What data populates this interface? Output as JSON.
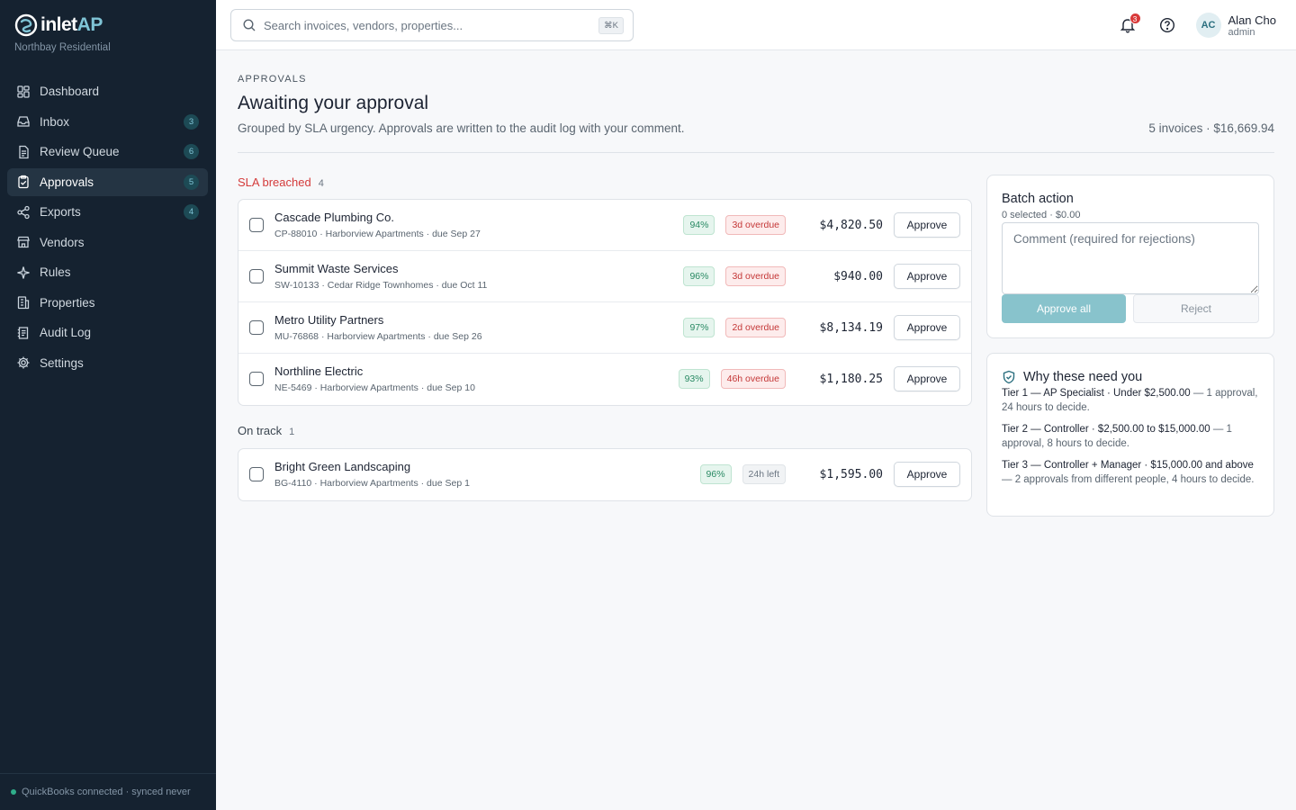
{
  "brand": {
    "name_main": "inlet",
    "name_accent": "AP",
    "org": "Northbay Residential"
  },
  "nav": [
    {
      "label": "Dashboard",
      "icon": "dashboard-icon",
      "badge": ""
    },
    {
      "label": "Inbox",
      "icon": "inbox-icon",
      "badge": "3"
    },
    {
      "label": "Review Queue",
      "icon": "review-queue-icon",
      "badge": "6"
    },
    {
      "label": "Approvals",
      "icon": "approvals-icon",
      "badge": "5",
      "active": true
    },
    {
      "label": "Exports",
      "icon": "exports-icon",
      "badge": "4"
    },
    {
      "label": "Vendors",
      "icon": "vendors-icon",
      "badge": ""
    },
    {
      "label": "Rules",
      "icon": "rules-icon",
      "badge": ""
    },
    {
      "label": "Properties",
      "icon": "properties-icon",
      "badge": ""
    },
    {
      "label": "Audit Log",
      "icon": "audit-log-icon",
      "badge": ""
    },
    {
      "label": "Settings",
      "icon": "gear-icon",
      "badge": ""
    }
  ],
  "sidebar_footer": "QuickBooks connected · synced never",
  "search": {
    "placeholder": "Search invoices, vendors, properties...",
    "shortcut": "⌘K"
  },
  "notifications": {
    "count": "3"
  },
  "user": {
    "initials": "AC",
    "name": "Alan Cho",
    "role": "admin"
  },
  "page": {
    "eyebrow": "APPROVALS",
    "title": "Awaiting your approval",
    "subtitle": "Grouped by SLA urgency. Approvals are written to the audit log with your comment.",
    "summary": "5 invoices · $16,669.94"
  },
  "groups": {
    "breached": {
      "label": "SLA breached",
      "count": "4",
      "rows": [
        {
          "vendor": "Cascade Plumbing Co.",
          "meta": "CP-88010 · Harborview Apartments · due Sep 27",
          "confidence": "94%",
          "sla": "3d overdue",
          "amount": "$4,820.50",
          "action": "Approve"
        },
        {
          "vendor": "Summit Waste Services",
          "meta": "SW-10133 · Cedar Ridge Townhomes · due Oct 11",
          "confidence": "96%",
          "sla": "3d overdue",
          "amount": "$940.00",
          "action": "Approve"
        },
        {
          "vendor": "Metro Utility Partners",
          "meta": "MU-76868 · Harborview Apartments · due Sep 26",
          "confidence": "97%",
          "sla": "2d overdue",
          "amount": "$8,134.19",
          "action": "Approve"
        },
        {
          "vendor": "Northline Electric",
          "meta": "NE-5469 · Harborview Apartments · due Sep 10",
          "confidence": "93%",
          "sla": "46h overdue",
          "amount": "$1,180.25",
          "action": "Approve"
        }
      ]
    },
    "on_track": {
      "label": "On track",
      "count": "1",
      "rows": [
        {
          "vendor": "Bright Green Landscaping",
          "meta": "BG-4110 · Harborview Apartments · due Sep 1",
          "confidence": "96%",
          "sla": "24h left",
          "amount": "$1,595.00",
          "action": "Approve"
        }
      ]
    }
  },
  "batch": {
    "title": "Batch action",
    "selection": "0 selected · $0.00",
    "comment_placeholder": "Comment (required for rejections)",
    "approve_all": "Approve all",
    "reject": "Reject"
  },
  "why": {
    "title": "Why these need you",
    "tiers": [
      {
        "head": "Tier 1 — AP Specialist · Under $2,500.00",
        "rest": " — 1 approval, 24 hours to decide."
      },
      {
        "head": "Tier 2 — Controller · $2,500.00 to $15,000.00",
        "rest": " — 1 approval, 8 hours to decide."
      },
      {
        "head": "Tier 3 — Controller + Manager · $15,000.00 and above",
        "rest": " — 2 approvals from different people, 4 hours to decide."
      }
    ]
  },
  "colors": {
    "sidebar_bg": "#152230",
    "accent": "#7fc4d6",
    "danger": "#d43b3b",
    "success": "#2a8a64",
    "approve_all_bg": "#88c3cc"
  }
}
